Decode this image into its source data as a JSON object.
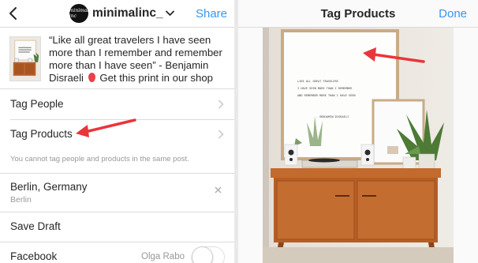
{
  "left": {
    "nav": {
      "account_name": "minimalinc_",
      "avatar_text": "minimal inc",
      "share_label": "Share"
    },
    "post": {
      "caption": "“Like all great travelers I have seen more than I remember and remember more than I have seen” - Benjamin Disraeli",
      "caption_tail": "Get this print in our shop"
    },
    "rows": {
      "tag_people": "Tag People",
      "tag_products": "Tag Products",
      "note": "You cannot tag people and products in the same post.",
      "location": "Berlin, Germany",
      "location_sub": "Berlin",
      "save_draft": "Save Draft",
      "facebook": "Facebook",
      "facebook_account": "Olga Rabo"
    }
  },
  "right": {
    "nav": {
      "title": "Tag Products",
      "done_label": "Done"
    },
    "print_text": [
      "LIKE ALL GREAT TRAVELERS",
      "I HAVE SEEN MORE THAN I REMEMBER",
      "AND REMEMBER MORE THAN I HAVE SEEN",
      "- BENJAMIN DISRAELI"
    ]
  },
  "colors": {
    "accent": "#3897f0",
    "arrow": "#e8363b",
    "divider": "#dbdbdb",
    "secondary_text": "#999999"
  }
}
